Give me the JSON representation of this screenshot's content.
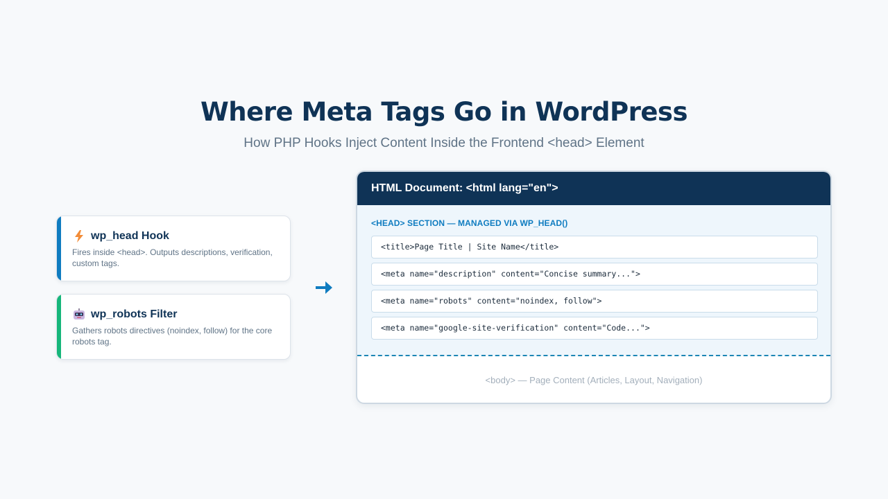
{
  "header": {
    "title": "Where Meta Tags Go in WordPress",
    "subtitle": "How PHP Hooks Inject Content Inside the Frontend <head> Element"
  },
  "hooks": [
    {
      "icon": "lightning-icon",
      "title": "wp_head Hook",
      "description": "Fires inside <head>. Outputs descriptions, verification, custom tags.",
      "accent_color": "#0f7cc0"
    },
    {
      "icon": "robot-icon",
      "title": "wp_robots Filter",
      "description": "Gathers robots directives (noindex, follow) for the core robots tag.",
      "accent_color": "#16b67a"
    }
  ],
  "arrow_icon": "arrow-right-icon",
  "document": {
    "header": "HTML Document: <html lang=\"en\">",
    "head_label": "<HEAD> SECTION — MANAGED VIA WP_HEAD()",
    "tags": [
      "<title>Page Title | Site Name</title>",
      "<meta name=\"description\" content=\"Concise summary...\">",
      "<meta name=\"robots\" content=\"noindex, follow\">",
      "<meta name=\"google-site-verification\" content=\"Code...\">"
    ],
    "body_label": "<body> — Page Content (Articles, Layout, Navigation)"
  },
  "colors": {
    "brand_navy": "#0f3356",
    "accent_blue": "#0f7cc0",
    "accent_green": "#16b67a",
    "head_bg": "#eef6fc"
  }
}
